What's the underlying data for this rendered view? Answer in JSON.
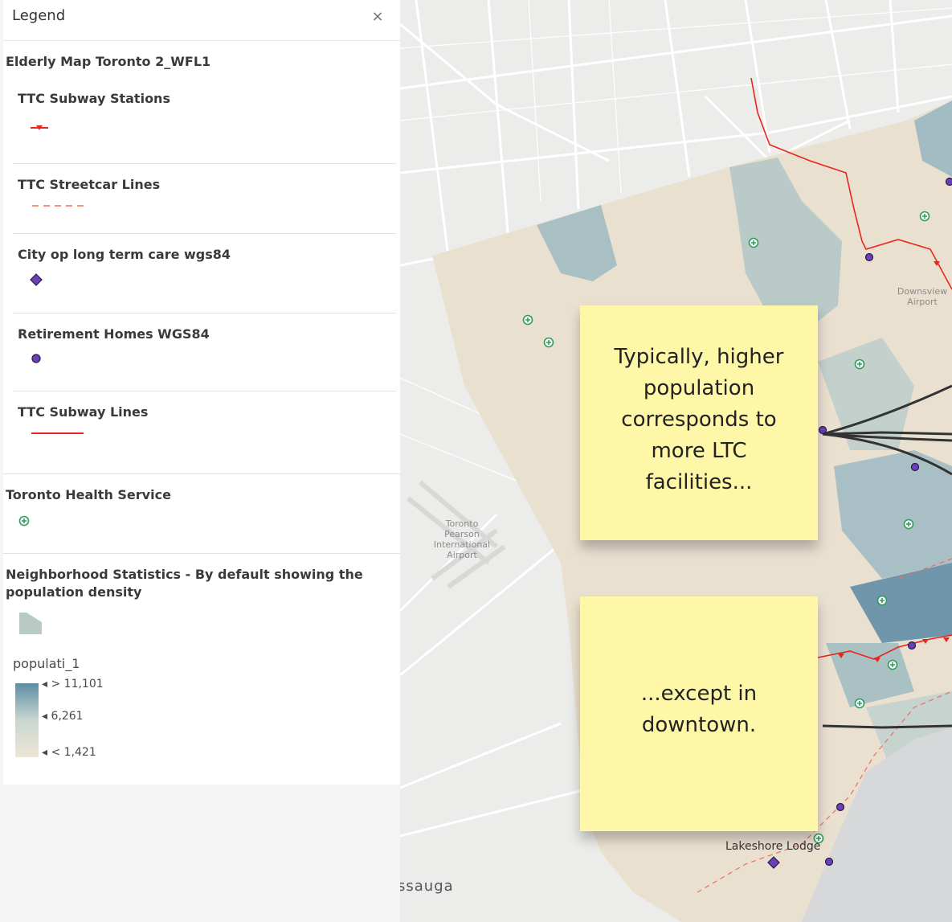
{
  "legend": {
    "title": "Legend",
    "close_symbol": "×",
    "group1_title": "Elderly Map Toronto 2_WFL1",
    "layers": [
      {
        "label": "TTC Subway Stations",
        "symbol": "subway-station-icon"
      },
      {
        "label": "TTC Streetcar Lines",
        "symbol": "dashed-red-line"
      },
      {
        "label": "City op long term care wgs84",
        "symbol": "purple-diamond"
      },
      {
        "label": "Retirement Homes WGS84",
        "symbol": "purple-dot"
      },
      {
        "label": "TTC Subway Lines",
        "symbol": "red-line"
      }
    ],
    "group2_title": "Toronto Health Service",
    "group3_title": "Neighborhood Statistics - By default showing the population density",
    "ramp_field": "populati_1",
    "ramp_labels": [
      "> 11,101",
      "6,261",
      "< 1,421"
    ],
    "colors": {
      "high": "#5d8ea4",
      "mid": "#c9d6d0",
      "low": "#ede5d6",
      "subway": "#e8261d",
      "facility": "#6b3fb5",
      "health": "#2e9c5c"
    }
  },
  "map": {
    "notes": [
      {
        "text": "Typically, higher population corresponds to more LTC facilities..."
      },
      {
        "text": "...except in downtown."
      }
    ],
    "labels": {
      "airport1": "Toronto Pearson International Airport",
      "airport2": "Downsview Airport",
      "lodge": "Lakeshore Lodge",
      "city": "ssauga"
    }
  }
}
